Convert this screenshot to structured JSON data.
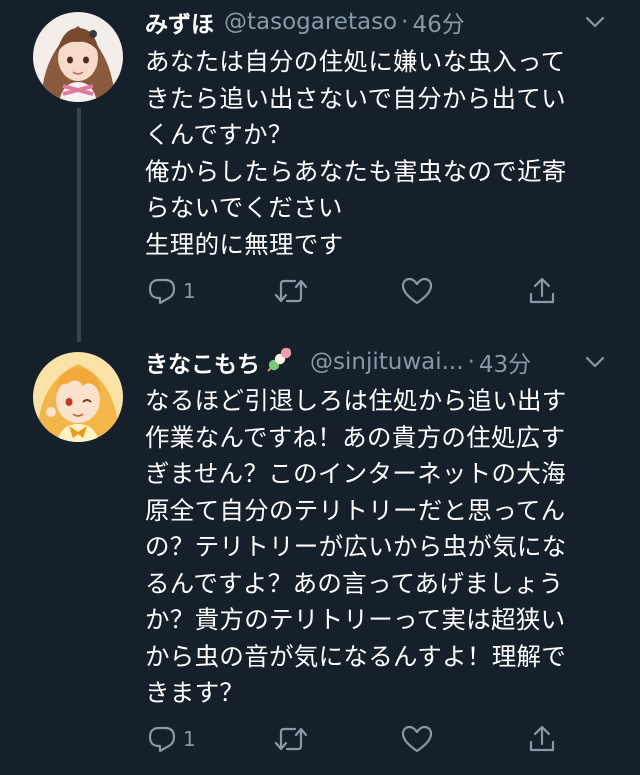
{
  "tweets": [
    {
      "name": "みずほ",
      "handle": "@tasogaretaso",
      "dot": "·",
      "time": "46分",
      "text": "あなたは自分の住処に嫌いな虫入って\nきたら追い出さないで自分から出てい\nくんですか？\n俺からしたらあなたも害虫なので近寄\nらないでください\n生理的に無理です",
      "reply_count": "1",
      "avatar_icon": "avatar-girl-brown-hair"
    },
    {
      "name": "きなこもち",
      "name_emoji": "dango-icon",
      "handle": "@sinjituwai...",
      "dot": "·",
      "time": "43分",
      "text": "なるほど引退しろは住処から追い出す\n作業なんですね！あの貴方の住処広す\nぎません？このインターネットの大海\n原全て自分のテリトリーだと思ってん\nの？テリトリーが広いから虫が気にな\nるんですよ？あの言ってあげましょう\nか？貴方のテリトリーって実は超狭い\nから虫の音が気になるんすよ！理解で\nきます？",
      "reply_count": "1",
      "avatar_icon": "avatar-girl-blonde-hair"
    }
  ],
  "colors": {
    "background": "#15202b",
    "secondary_text": "#8899a6",
    "thread_line": "#38444d"
  }
}
